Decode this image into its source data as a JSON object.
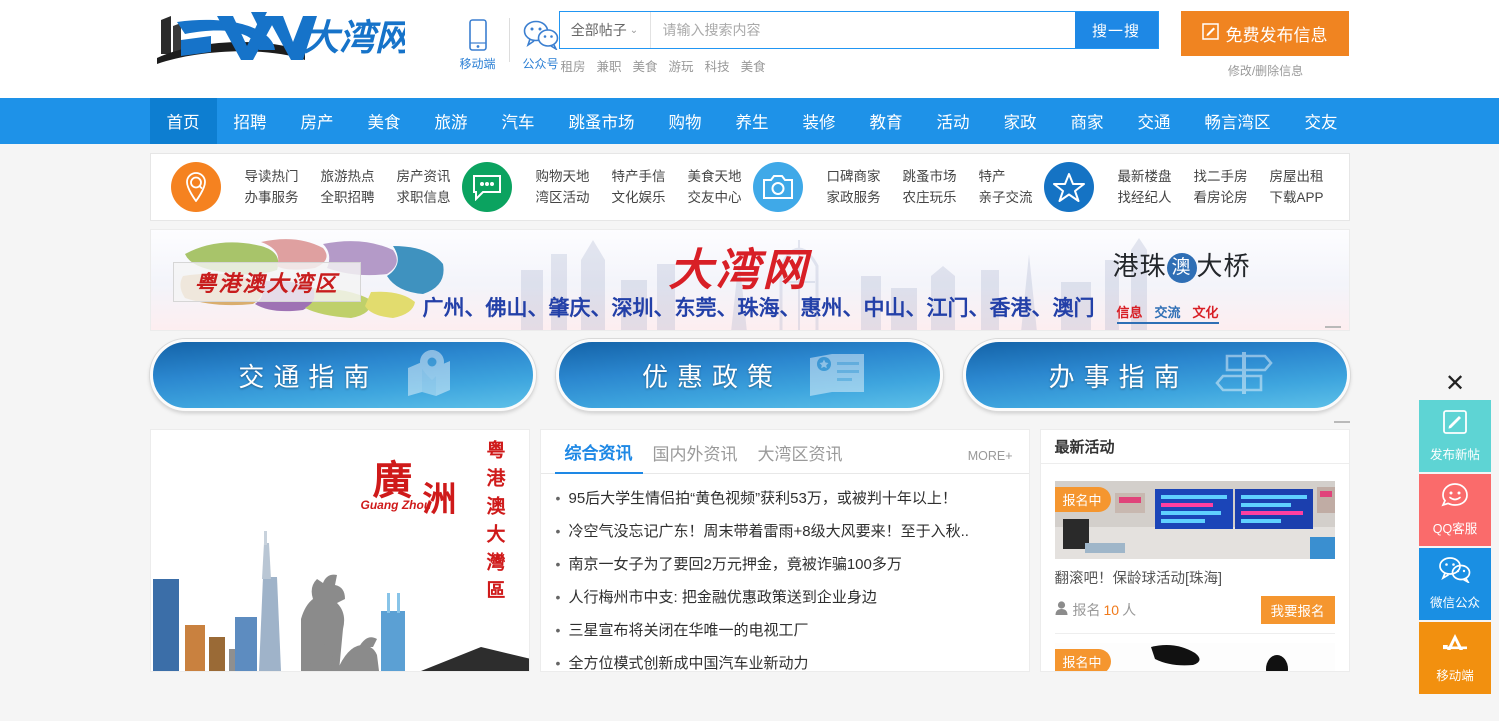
{
  "site": {
    "logo_text": "大湾网",
    "logo_mark": "DW"
  },
  "header": {
    "qr": [
      {
        "icon": "mobile-phone-icon",
        "label": "移动端"
      },
      {
        "icon": "wechat-icon",
        "label": "公众号"
      }
    ],
    "search": {
      "category": "全部帖子",
      "caret": "⌄",
      "placeholder": "请输入搜索内容",
      "value": "",
      "button": "搜一搜",
      "hot_tags": [
        "租房",
        "兼职",
        "美食",
        "游玩",
        "科技",
        "美食"
      ]
    },
    "publish": {
      "icon": "edit-square-icon",
      "label": "免费发布信息",
      "sub_label": "修改/删除信息",
      "color": "#f08421"
    }
  },
  "nav": {
    "active_index": 0,
    "items": [
      "首页",
      "招聘",
      "房产",
      "美食",
      "旅游",
      "汽车",
      "跳蚤市场",
      "购物",
      "养生",
      "装修",
      "教育",
      "活动",
      "家政",
      "商家",
      "交通",
      "畅言湾区",
      "交友"
    ]
  },
  "quick_links": [
    {
      "icon": "location-pin-icon",
      "color": "#f58220",
      "columns": [
        [
          "导读热门",
          "办事服务"
        ],
        [
          "旅游热点",
          "全职招聘"
        ],
        [
          "房产资讯",
          "求职信息"
        ]
      ]
    },
    {
      "icon": "chat-bubble-icon",
      "color": "#0ba360",
      "columns": [
        [
          "购物天地",
          "湾区活动"
        ],
        [
          "特产手信",
          "文化娱乐"
        ],
        [
          "美食天地",
          "交友中心"
        ]
      ]
    },
    {
      "icon": "camera-icon",
      "color": "#3fa9e8",
      "columns": [
        [
          "口碑商家",
          "家政服务"
        ],
        [
          "跳蚤市场",
          "农庄玩乐"
        ],
        [
          "特产",
          "亲子交流"
        ]
      ]
    },
    {
      "icon": "star-icon",
      "color": "#1573c4",
      "columns": [
        [
          "最新楼盘",
          "找经纪人"
        ],
        [
          "找二手房",
          "看房论房"
        ],
        [
          "房屋出租",
          "下载APP"
        ]
      ]
    }
  ],
  "banner": {
    "plate_text": "粤港澳大湾区",
    "cities": "广州、佛山、肇庆、深圳、东莞、珠海、惠州、中山、江门、香港、澳门",
    "big_title": "大湾网",
    "bridge_pre": "港珠",
    "bridge_circle": "澳",
    "bridge_post": "大桥",
    "tags": [
      {
        "text": "信息",
        "color": "#d81f26"
      },
      {
        "text": "交流",
        "color": "#2f6fb5"
      },
      {
        "text": "文化",
        "color": "#d81f26"
      }
    ]
  },
  "pills": [
    {
      "label": "交通指南",
      "icon": "map-pin-fold-icon"
    },
    {
      "label": "优惠政策",
      "icon": "badge-document-icon"
    },
    {
      "label": "办事指南",
      "icon": "signpost-icon"
    }
  ],
  "photo_card": {
    "city_cn_1": "廣",
    "city_cn_2": "洲",
    "pinyin": "Guang Zhou",
    "vertical_text": "粤港澳大灣區"
  },
  "news": {
    "tabs": [
      {
        "label": "综合资讯",
        "active": true
      },
      {
        "label": "国内外资讯",
        "active": false
      },
      {
        "label": "大湾区资讯",
        "active": false
      }
    ],
    "more_label": "MORE+",
    "items": [
      "95后大学生情侣拍“黄色视频”获利53万，或被判十年以上！",
      "冷空气没忘记广东！周末带着雷雨+8级大风要来！至于入秋..",
      "南京一女子为了要回2万元押金，竟被诈骗100多万",
      "人行梅州市中支: 把金融优惠政策送到企业身边",
      "三星宣布将关闭在华唯一的电视工厂",
      "全方位模式创新成中国汽车业新动力"
    ]
  },
  "activities": {
    "title": "最新活动",
    "cards": [
      {
        "badge": "报名中",
        "title": "翻滚吧！保龄球活动[珠海]",
        "meta_icon": "user-icon",
        "meta_label": "报名",
        "meta_count": "10",
        "meta_unit": "人",
        "button": "我要报名"
      },
      {
        "badge": "报名中",
        "title": "",
        "meta_icon": "user-icon",
        "meta_label": "",
        "meta_count": "",
        "meta_unit": "",
        "button": ""
      }
    ]
  },
  "float_toolbar": {
    "close_icon": "close-icon",
    "close_glyph": "✕",
    "buttons": [
      {
        "icon": "edit-square-icon",
        "label": "发布新帖",
        "color": "#5ed4d4"
      },
      {
        "icon": "qq-smiley-icon",
        "label": "QQ客服",
        "color": "#fa6b6b"
      },
      {
        "icon": "wechat-icon",
        "label": "微信公众",
        "color": "#1a8fe3"
      },
      {
        "icon": "app-store-icon",
        "label": "移动端",
        "color": "#f2900f"
      }
    ]
  }
}
